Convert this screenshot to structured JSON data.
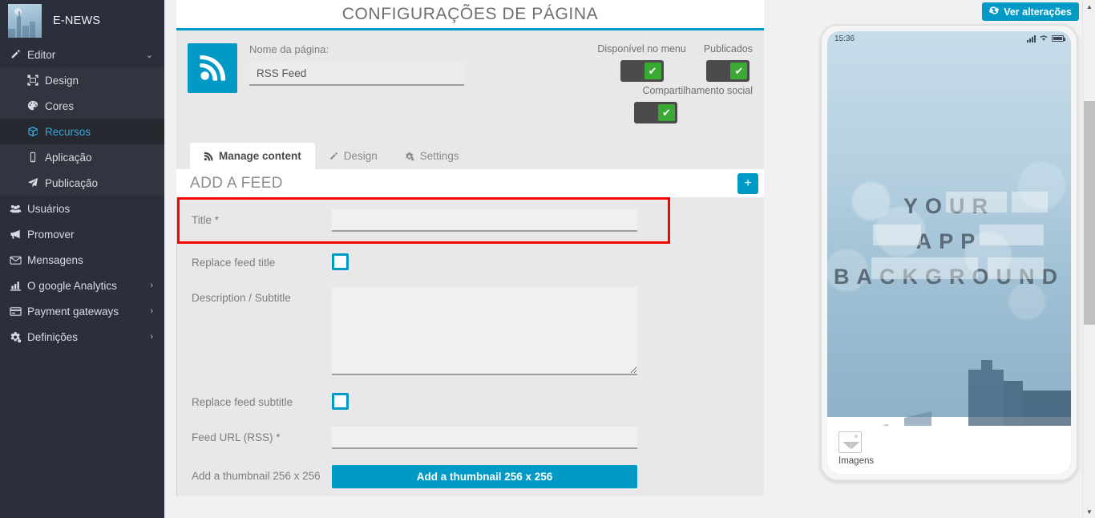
{
  "sidebar": {
    "brand": {
      "name": "E-NEWS",
      "thumb_alt": "city-skyline-thumbnail"
    },
    "editor": {
      "label": "Editor",
      "icon": "pencil-icon",
      "caret": "⌄"
    },
    "sub_items": [
      {
        "label": "Design",
        "icon": "design-icon"
      },
      {
        "label": "Cores",
        "icon": "palette-icon"
      },
      {
        "label": "Recursos",
        "icon": "cube-icon",
        "active": true
      },
      {
        "label": "Aplicação",
        "icon": "mobile-icon"
      },
      {
        "label": "Publicação",
        "icon": "paper-plane-icon"
      }
    ],
    "main_items": [
      {
        "label": "Usuários",
        "icon": "users-icon",
        "caret": ""
      },
      {
        "label": "Promover",
        "icon": "megaphone-icon",
        "caret": ""
      },
      {
        "label": "Mensagens",
        "icon": "envelope-icon",
        "caret": ""
      },
      {
        "label": "O google Analytics",
        "icon": "bar-chart-icon",
        "caret": "›"
      },
      {
        "label": "Payment gateways",
        "icon": "credit-card-icon",
        "caret": "›"
      },
      {
        "label": "Definições",
        "icon": "gears-icon",
        "caret": "›"
      }
    ]
  },
  "panel": {
    "title": "CONFIGURAÇÕES DE PÁGINA",
    "page_icon": "rss-icon",
    "page_name_label": "Nome da página:",
    "page_name_value": "RSS Feed",
    "page_name_placeholder": "",
    "toggles": [
      {
        "label": "Disponível no menu",
        "state": "on",
        "check": "✔"
      },
      {
        "label": "Publicados",
        "state": "on",
        "check": "✔"
      }
    ],
    "social_toggle": {
      "label": "Compartilhamento social",
      "state": "on",
      "check": "✔"
    }
  },
  "tabs": [
    {
      "label": "Manage content",
      "icon": "rss-icon",
      "active": true
    },
    {
      "label": "Design",
      "icon": "pencil-icon",
      "active": false
    },
    {
      "label": "Settings",
      "icon": "gears-icon",
      "active": false
    }
  ],
  "feed": {
    "section_title": "ADD A FEED",
    "add_button_label": "+",
    "fields": {
      "title_label": "Title *",
      "title_value": "",
      "title_placeholder": "",
      "replace_feed_title_label": "Replace feed title",
      "replace_feed_title_checked": false,
      "description_label": "Description / Subtitle",
      "description_value": "",
      "description_placeholder": "",
      "replace_feed_subtitle_label": "Replace feed subtitle",
      "replace_feed_subtitle_checked": false,
      "feed_url_label": "Feed URL (RSS) *",
      "feed_url_value": "",
      "feed_url_placeholder": "",
      "thumbnail_label": "Add a thumbnail 256 x 256",
      "thumbnail_button_label": "Add a thumbnail 256 x 256"
    }
  },
  "preview": {
    "ver_alteracoes_label": "Ver alterações",
    "refresh_icon": "refresh-icon",
    "status_time": "15:36",
    "background_words": [
      "YOUR",
      "APP",
      "BACKGROUND"
    ],
    "footer_item_label": "Imagens",
    "footer_item_icon": "image-icon"
  },
  "colors": {
    "accent": "#019ac6",
    "sidebar_bg": "#2b2e3b",
    "sidebar_active": "#3aa7dd",
    "highlight_red": "#ff0000",
    "toggle_on_green": "#3aaa35",
    "panel_bg": "#e8e8e9"
  },
  "scrollbar": {
    "up_arrow": "▲",
    "down_arrow": "▼"
  }
}
